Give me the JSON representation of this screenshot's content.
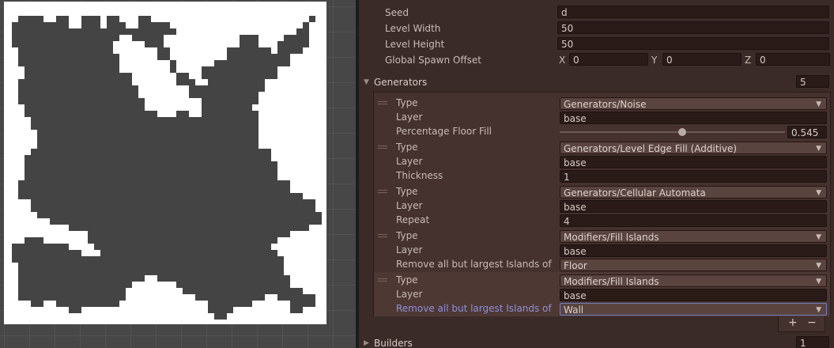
{
  "map": {
    "background": "#ffffff",
    "wall_color": "#444444"
  },
  "inspector": {
    "fields": {
      "seed_label": "Seed",
      "seed_value": "d",
      "width_label": "Level Width",
      "width_value": "50",
      "height_label": "Level Height",
      "height_value": "50",
      "offset_label": "Global Spawn Offset",
      "x_label": "X",
      "x_value": "0",
      "y_label": "Y",
      "y_value": "0",
      "z_label": "Z",
      "z_value": "0"
    },
    "generators": {
      "label": "Generators",
      "count": "5",
      "items": [
        {
          "type_label": "Type",
          "type_value": "Generators/Noise",
          "layer_label": "Layer",
          "layer_value": "base",
          "param_label": "Percentage Floor Fill",
          "param_value": "0.545"
        },
        {
          "type_label": "Type",
          "type_value": "Generators/Level Edge Fill (Additive)",
          "layer_label": "Layer",
          "layer_value": "base",
          "param_label": "Thickness",
          "param_value": "1"
        },
        {
          "type_label": "Type",
          "type_value": "Generators/Cellular Automata",
          "layer_label": "Layer",
          "layer_value": "base",
          "param_label": "Repeat",
          "param_value": "4"
        },
        {
          "type_label": "Type",
          "type_value": "Modifiers/Fill Islands",
          "layer_label": "Layer",
          "layer_value": "base",
          "param_label": "Remove all but largest Islands of",
          "param_value": "Floor"
        },
        {
          "type_label": "Type",
          "type_value": "Modifiers/Fill Islands",
          "layer_label": "Layer",
          "layer_value": "base",
          "param_label": "Remove all but largest Islands of",
          "param_value": "Wall"
        }
      ],
      "add_label": "+",
      "remove_label": "−"
    },
    "builders": {
      "label": "Builders",
      "count": "1"
    }
  }
}
